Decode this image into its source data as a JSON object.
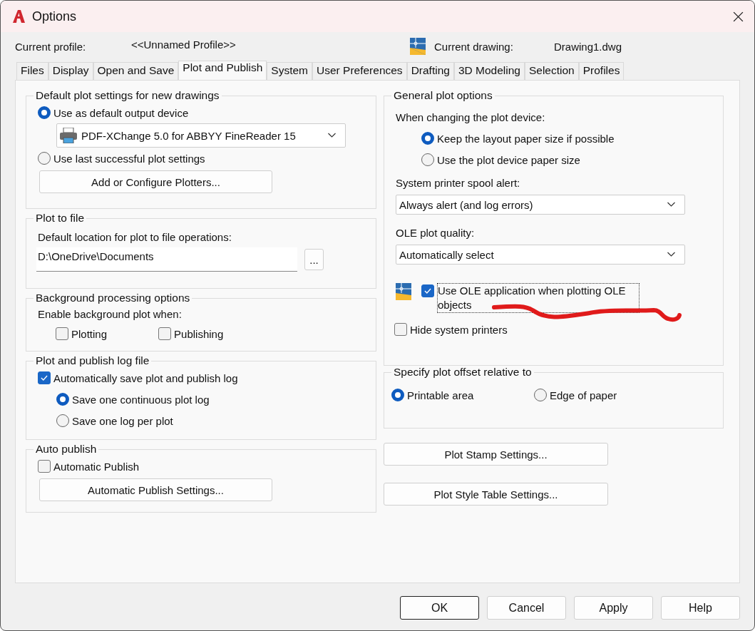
{
  "window": {
    "title": "Options"
  },
  "current_profile": {
    "label": "Current profile:",
    "value": "<<Unnamed Profile>>"
  },
  "current_drawing": {
    "label": "Current drawing:",
    "value": "Drawing1.dwg"
  },
  "tabs": [
    {
      "label": "Files",
      "selected": false
    },
    {
      "label": "Display",
      "selected": false
    },
    {
      "label": "Open and Save",
      "selected": false
    },
    {
      "label": "Plot and Publish",
      "selected": true
    },
    {
      "label": "System",
      "selected": false
    },
    {
      "label": "User Preferences",
      "selected": false
    },
    {
      "label": "Drafting",
      "selected": false
    },
    {
      "label": "3D Modeling",
      "selected": false
    },
    {
      "label": "Selection",
      "selected": false
    },
    {
      "label": "Profiles",
      "selected": false
    }
  ],
  "default_plot_settings": {
    "title": "Default plot settings for new drawings",
    "options": [
      {
        "label": "Use as default output device",
        "selected": true
      },
      {
        "label": "Use last successful plot settings",
        "selected": false
      }
    ],
    "device": "PDF-XChange 5.0 for ABBYY FineReader 15",
    "button": "Add or Configure Plotters..."
  },
  "plot_to_file": {
    "title": "Plot to file",
    "label": "Default location for plot to file operations:",
    "value": "D:\\OneDrive\\Documents",
    "browse_button": "..."
  },
  "background_processing": {
    "title": "Background processing options",
    "label": "Enable background plot when:",
    "options": [
      {
        "label": "Plotting",
        "checked": false
      },
      {
        "label": "Publishing",
        "checked": false
      }
    ]
  },
  "log_file": {
    "title": "Plot and publish log file",
    "auto_save": {
      "label": "Automatically save plot and publish log",
      "checked": true
    },
    "options": [
      {
        "label": "Save one continuous plot log",
        "selected": true
      },
      {
        "label": "Save one log per plot",
        "selected": false
      }
    ]
  },
  "auto_publish": {
    "title": "Auto publish",
    "auto": {
      "label": "Automatic Publish",
      "checked": false
    },
    "button": "Automatic Publish Settings..."
  },
  "general_plot_options": {
    "title": "General plot options",
    "device_change_label": "When changing the plot device:",
    "paper_options": [
      {
        "label": "Keep the layout paper size if possible",
        "selected": true
      },
      {
        "label": "Use the plot device paper size",
        "selected": false
      }
    ],
    "spool_label": "System printer spool alert:",
    "spool_value": "Always alert (and log errors)",
    "ole_label": "OLE plot quality:",
    "ole_value": "Automatically select",
    "use_ole": {
      "label": "Use OLE application when plotting OLE objects",
      "checked": true,
      "focused": true
    },
    "hide_printers": {
      "label": "Hide system printers",
      "checked": false
    }
  },
  "plot_offset": {
    "title": "Specify plot offset relative to",
    "options": [
      {
        "label": "Printable area",
        "selected": true
      },
      {
        "label": "Edge of paper",
        "selected": false
      }
    ]
  },
  "side_buttons": [
    "Plot Stamp Settings...",
    "Plot Style Table Settings..."
  ],
  "buttons": [
    {
      "label": "OK",
      "default": true
    },
    {
      "label": "Cancel",
      "default": false
    },
    {
      "label": "Apply",
      "default": false
    },
    {
      "label": "Help",
      "default": false
    }
  ]
}
